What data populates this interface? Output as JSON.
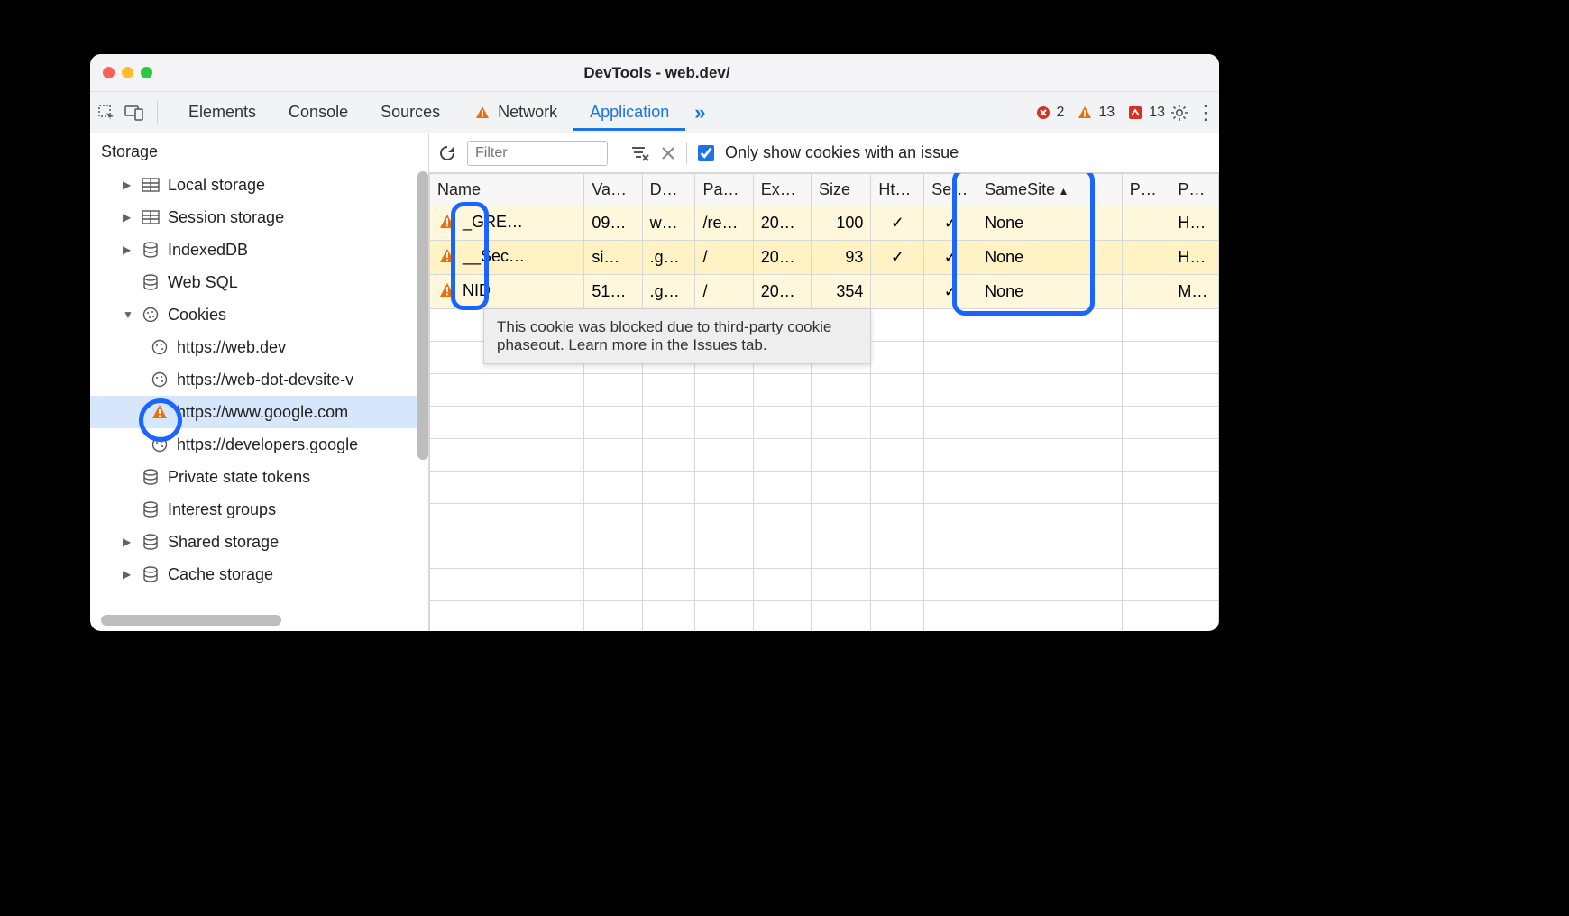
{
  "window_title": "DevTools - web.dev/",
  "tabs": {
    "elements": "Elements",
    "console": "Console",
    "sources": "Sources",
    "network": "Network",
    "application": "Application"
  },
  "counters": {
    "errors": "2",
    "warnings": "13",
    "issues": "13"
  },
  "sidebar": {
    "section": "Storage",
    "local_storage": "Local storage",
    "session_storage": "Session storage",
    "indexeddb": "IndexedDB",
    "websql": "Web SQL",
    "cookies": "Cookies",
    "cookie_origins": {
      "webdev": "https://web.dev",
      "webdot": "https://web-dot-devsite-v",
      "google": "https://www.google.com",
      "developers": "https://developers.google"
    },
    "private_state": "Private state tokens",
    "interest_groups": "Interest groups",
    "shared_storage": "Shared storage",
    "cache_storage": "Cache storage"
  },
  "toolbar": {
    "filter_placeholder": "Filter",
    "only_issues": "Only show cookies with an issue"
  },
  "columns": {
    "name": "Name",
    "value": "Va…",
    "domain": "D…",
    "path": "Pa…",
    "expires": "Ex…",
    "size": "Size",
    "http": "Ht…",
    "secure": "Se…",
    "samesite": "SameSite",
    "partition": "P…",
    "priority": "P…"
  },
  "rows": [
    {
      "name": "_GRE…",
      "value": "09…",
      "domain": "w…",
      "path": "/re…",
      "expires": "20…",
      "size": "100",
      "http": "✓",
      "secure": "✓",
      "samesite": "None",
      "partition": "",
      "priority": "H…"
    },
    {
      "name": "__Sec…",
      "value": "si…",
      "domain": ".g…",
      "path": "/",
      "expires": "20…",
      "size": "93",
      "http": "✓",
      "secure": "✓",
      "samesite": "None",
      "partition": "",
      "priority": "H…"
    },
    {
      "name": "NID",
      "value": "51…",
      "domain": ".g…",
      "path": "/",
      "expires": "20…",
      "size": "354",
      "http": "",
      "secure": "✓",
      "samesite": "None",
      "partition": "",
      "priority": "M…"
    }
  ],
  "tooltip": "This cookie was blocked due to third-party cookie phaseout. Learn more in the Issues tab."
}
